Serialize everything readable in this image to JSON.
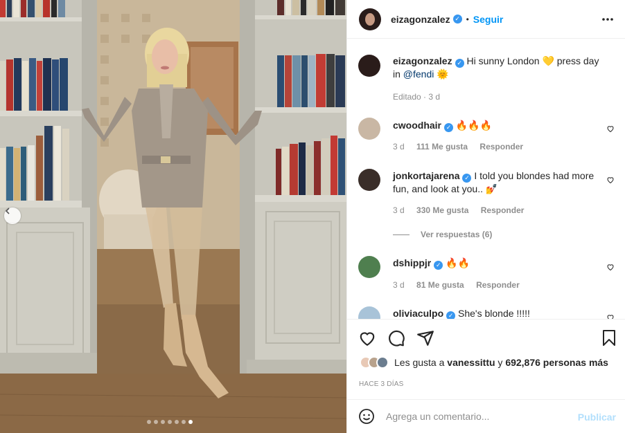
{
  "post": {
    "carousel": {
      "total": 7,
      "active_index": 6
    }
  },
  "header": {
    "username": "eizagonzalez",
    "separator": "•",
    "follow_label": "Seguir"
  },
  "caption": {
    "username": "eizagonzalez",
    "text": "Hi sunny London 💛 press day in",
    "mention": "@fendi",
    "emoji_end": "🌞",
    "meta": "Editado · 3 d"
  },
  "comments": [
    {
      "username": "cwoodhair",
      "text": "🔥🔥🔥",
      "time": "3 d",
      "likes": "111 Me gusta",
      "reply": "Responder"
    },
    {
      "username": "jonkortajarena",
      "text": "I told you blondes had more fun, and look at you.. 💅",
      "time": "3 d",
      "likes": "330 Me gusta",
      "reply": "Responder",
      "view_replies": "Ver respuestas (6)"
    },
    {
      "username": "dshippjr",
      "text": "🔥🔥",
      "time": "3 d",
      "likes": "81 Me gusta",
      "reply": "Responder"
    },
    {
      "username": "oliviaculpo",
      "text": "She's blonde !!!!!",
      "time": "",
      "likes": "",
      "reply": ""
    }
  ],
  "likes": {
    "prefix": "Les gusta a",
    "user": "vanessittu",
    "connector": "y",
    "others": "692,876 personas más"
  },
  "timestamp": "HACE 3 DÍAS",
  "add_comment": {
    "placeholder": "Agrega un comentario...",
    "publish_label": "Publicar"
  },
  "colors": {
    "accent": "#0095f6",
    "verified": "#3897f0",
    "publish_disabled": "#b2dffc"
  },
  "icons": [
    "chevron-left-icon",
    "more-icon",
    "heart-icon",
    "comment-icon",
    "share-icon",
    "bookmark-icon",
    "emoji-icon",
    "verified-icon"
  ]
}
